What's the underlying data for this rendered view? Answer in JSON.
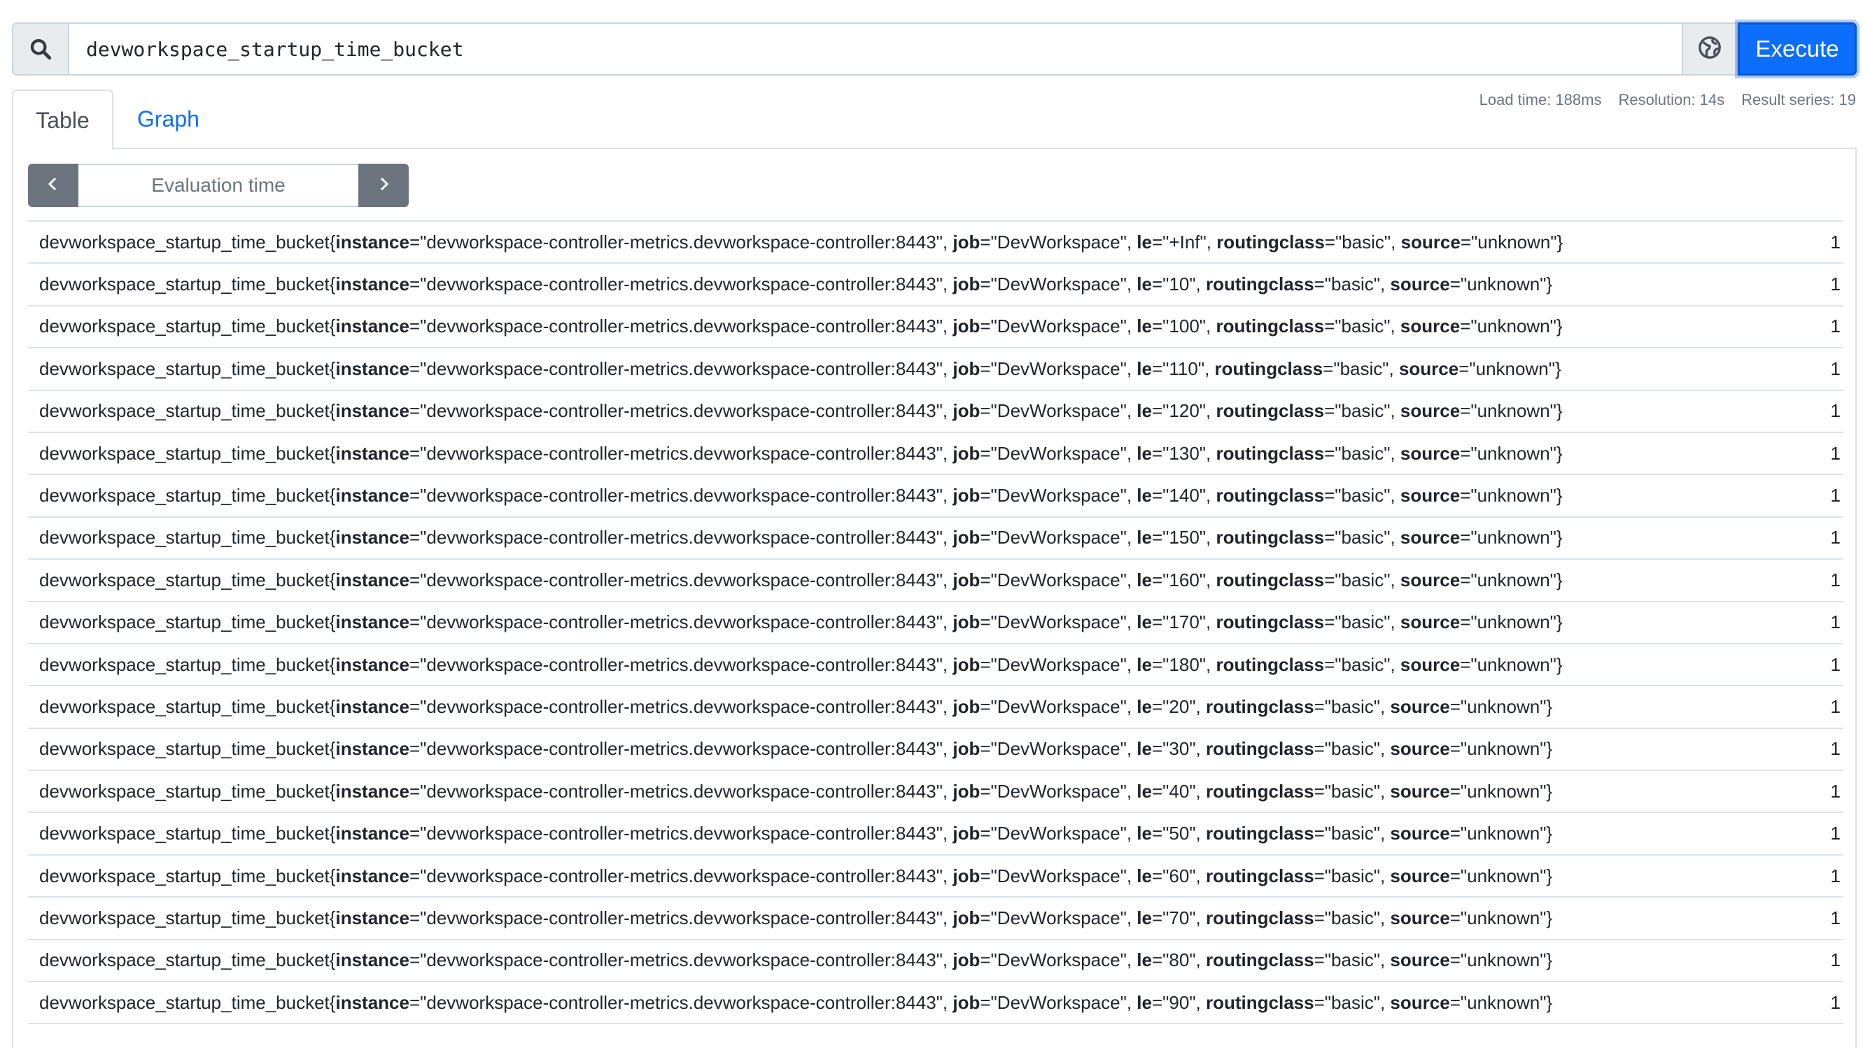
{
  "query": {
    "expression": "devworkspace_startup_time_bucket",
    "execute_label": "Execute",
    "icons": {
      "search": "search-icon",
      "metrics_explorer": "globe-icon"
    }
  },
  "tabs": [
    {
      "label": "Table",
      "active": true
    },
    {
      "label": "Graph",
      "active": false
    }
  ],
  "stats": {
    "load_time": "Load time: 188ms",
    "resolution": "Resolution: 14s",
    "result_series": "Result series: 19"
  },
  "eval_time": {
    "placeholder": "Evaluation time",
    "prev_icon": "chevron-left-icon",
    "next_icon": "chevron-right-icon"
  },
  "results": {
    "metric": "devworkspace_startup_time_bucket",
    "instance": "devworkspace-controller-metrics.devworkspace-controller:8443",
    "job": "DevWorkspace",
    "routingclass": "basic",
    "source": "unknown",
    "rows": [
      {
        "le": "+Inf",
        "value": "1"
      },
      {
        "le": "10",
        "value": "1"
      },
      {
        "le": "100",
        "value": "1"
      },
      {
        "le": "110",
        "value": "1"
      },
      {
        "le": "120",
        "value": "1"
      },
      {
        "le": "130",
        "value": "1"
      },
      {
        "le": "140",
        "value": "1"
      },
      {
        "le": "150",
        "value": "1"
      },
      {
        "le": "160",
        "value": "1"
      },
      {
        "le": "170",
        "value": "1"
      },
      {
        "le": "180",
        "value": "1"
      },
      {
        "le": "20",
        "value": "1"
      },
      {
        "le": "30",
        "value": "1"
      },
      {
        "le": "40",
        "value": "1"
      },
      {
        "le": "50",
        "value": "1"
      },
      {
        "le": "60",
        "value": "1"
      },
      {
        "le": "70",
        "value": "1"
      },
      {
        "le": "80",
        "value": "1"
      },
      {
        "le": "90",
        "value": "1"
      }
    ]
  },
  "colors": {
    "primary": "#0d6efd",
    "secondary": "#6c757d"
  }
}
